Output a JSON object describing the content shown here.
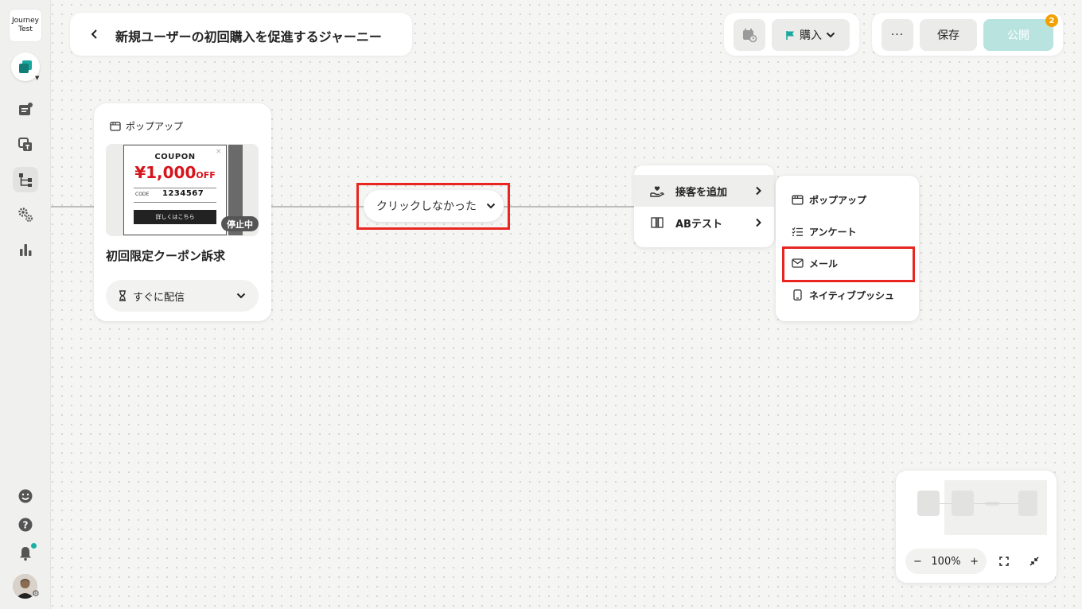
{
  "app": {
    "logo_text": "Journey\nTest"
  },
  "header": {
    "back_icon": "chevron-left-icon",
    "title": "新規ユーザーの初回購入を促進するジャーニー",
    "goal_label": "購入",
    "save_label": "保存",
    "publish_label": "公開",
    "publish_badge": "2",
    "more_label": "···"
  },
  "popup_node": {
    "type_label": "ポップアップ",
    "preview": {
      "coupon_title": "COUPON",
      "amount": "¥1,000",
      "amount_suffix": "OFF",
      "code_label": "CODE",
      "code": "1234567",
      "button_label": "詳しくはこちら",
      "close_glyph": "×"
    },
    "status": "停止中",
    "name": "初回限定クーポン訴求",
    "delivery": "すぐに配信"
  },
  "condition_node": {
    "label": "クリックしなかった"
  },
  "add_menu": {
    "items": [
      {
        "label": "接客を追加",
        "icon": "hand-heart-icon"
      },
      {
        "label": "ABテスト",
        "icon": "split-icon"
      }
    ]
  },
  "sub_menu": {
    "items": [
      {
        "label": "ポップアップ",
        "icon": "popup-window-icon"
      },
      {
        "label": "アンケート",
        "icon": "checklist-icon"
      },
      {
        "label": "メール",
        "icon": "mail-icon"
      },
      {
        "label": "ネイティブプッシュ",
        "icon": "mobile-icon"
      }
    ]
  },
  "minimap": {
    "zoom": "100%",
    "zoom_out": "−",
    "zoom_in": "+"
  },
  "colors": {
    "accent": "#1ab0a6",
    "highlight": "#e8251f",
    "publish_disabled": "#b9e3df",
    "badge": "#f2a100",
    "coupon_red": "#d6141b"
  }
}
